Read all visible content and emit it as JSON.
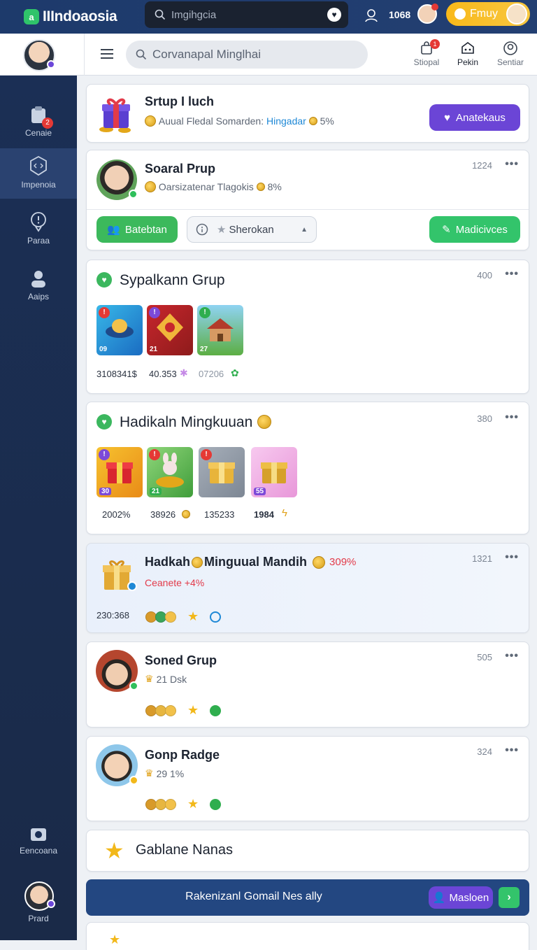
{
  "topbar": {
    "app_name": "IIIndoaosia",
    "search_placeholder": "Imgihgcia",
    "count": "1068",
    "cta_label": "Fmuy"
  },
  "header": {
    "search_placeholder": "Corvanapal Minglhai",
    "nav": [
      {
        "label": "Stiopal",
        "icon": "bag-icon",
        "badge": "1"
      },
      {
        "label": "Pekin",
        "icon": "store-icon"
      },
      {
        "label": "Sentiar",
        "icon": "user-circle-icon"
      }
    ]
  },
  "sidebar": {
    "items": [
      {
        "label": "Cenaie",
        "icon": "clipboard-icon",
        "badge": "2"
      },
      {
        "label": "Impenoia",
        "icon": "hexagon-icon"
      },
      {
        "label": "Paraa",
        "icon": "alert-pin-icon"
      },
      {
        "label": "Aaips",
        "icon": "person-icon"
      },
      {
        "label": "Eencoana",
        "icon": "camera-icon"
      }
    ],
    "profile_label": "Prard"
  },
  "cards": {
    "c1": {
      "title": "Srtup I luch",
      "sub_prefix": "Auual Fledal Somarden:",
      "sub_link": "Hingadar",
      "sub_pct": "5%",
      "button": "Anatekaus"
    },
    "c2": {
      "title": "Soaral Prup",
      "sub": "Oarsizatenar Tlagokis",
      "pct": "8%",
      "num": "1224",
      "btn1": "Batebtan",
      "btn2": "Sherokan",
      "btn3": "Madicivces"
    },
    "c3": {
      "title": "Sypalkann Grup",
      "num": "400",
      "tiles": [
        {
          "badge": "!",
          "n": "09"
        },
        {
          "badge": "!",
          "n": "21"
        },
        {
          "badge": "!",
          "n": "27"
        }
      ],
      "stats": [
        "3108341$",
        "40.353",
        "07206"
      ]
    },
    "c4": {
      "title": "Hadikaln Mingkuuan",
      "num": "380",
      "tiles": [
        {
          "badge": "!",
          "n": "30"
        },
        {
          "badge": "!",
          "n": "21"
        },
        {
          "badge": "!",
          "n": ""
        },
        {
          "badge": "",
          "n": "55"
        }
      ],
      "stats": [
        "2002%",
        "38926",
        "135233",
        "1984"
      ]
    },
    "c5": {
      "title_a": "Hadkah",
      "title_b": "Minguual Mandih",
      "pct": "309%",
      "num": "1321",
      "sub": "Ceanete +4%",
      "stat": "230:368"
    },
    "c6": {
      "title": "Soned Grup",
      "sub": "21 Dsk",
      "num": "505"
    },
    "c7": {
      "title": "Gonp Radge",
      "sub": "29 1%",
      "num": "324"
    },
    "c8": {
      "title": "Gablane Nanas"
    }
  },
  "footer": {
    "text": "Rakenizanl Gomail Nes ally",
    "button": "Masloen"
  },
  "colors": {
    "primary": "#1d3a6b",
    "accent_purple": "#6b45d6",
    "accent_green": "#33c46b",
    "gold": "#f9b91a"
  }
}
